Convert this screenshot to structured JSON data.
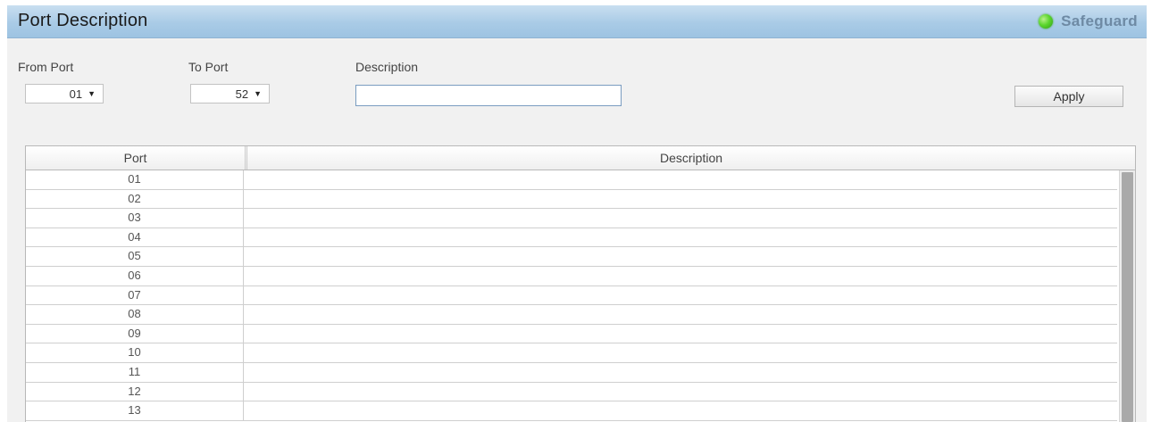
{
  "header": {
    "title": "Port Description",
    "safeguard_label": "Safeguard",
    "safeguard_status_color": "#4cc81e",
    "safeguard_icon": "status-green-dot-icon"
  },
  "form": {
    "from_port_label": "From Port",
    "from_port_value": "01",
    "to_port_label": "To Port",
    "to_port_value": "52",
    "description_label": "Description",
    "description_value": "",
    "apply_label": "Apply",
    "dropdown_icon": "triangle-down-icon"
  },
  "table": {
    "columns": [
      "Port",
      "Description"
    ],
    "rows": [
      {
        "port": "01",
        "description": ""
      },
      {
        "port": "02",
        "description": ""
      },
      {
        "port": "03",
        "description": ""
      },
      {
        "port": "04",
        "description": ""
      },
      {
        "port": "05",
        "description": ""
      },
      {
        "port": "06",
        "description": ""
      },
      {
        "port": "07",
        "description": ""
      },
      {
        "port": "08",
        "description": ""
      },
      {
        "port": "09",
        "description": ""
      },
      {
        "port": "10",
        "description": ""
      },
      {
        "port": "11",
        "description": ""
      },
      {
        "port": "12",
        "description": ""
      },
      {
        "port": "13",
        "description": ""
      }
    ]
  },
  "colors": {
    "header_bg": "#a9cbe6",
    "form_bg": "#f1f1f1",
    "safeguard_text": "#6e8aa4"
  }
}
